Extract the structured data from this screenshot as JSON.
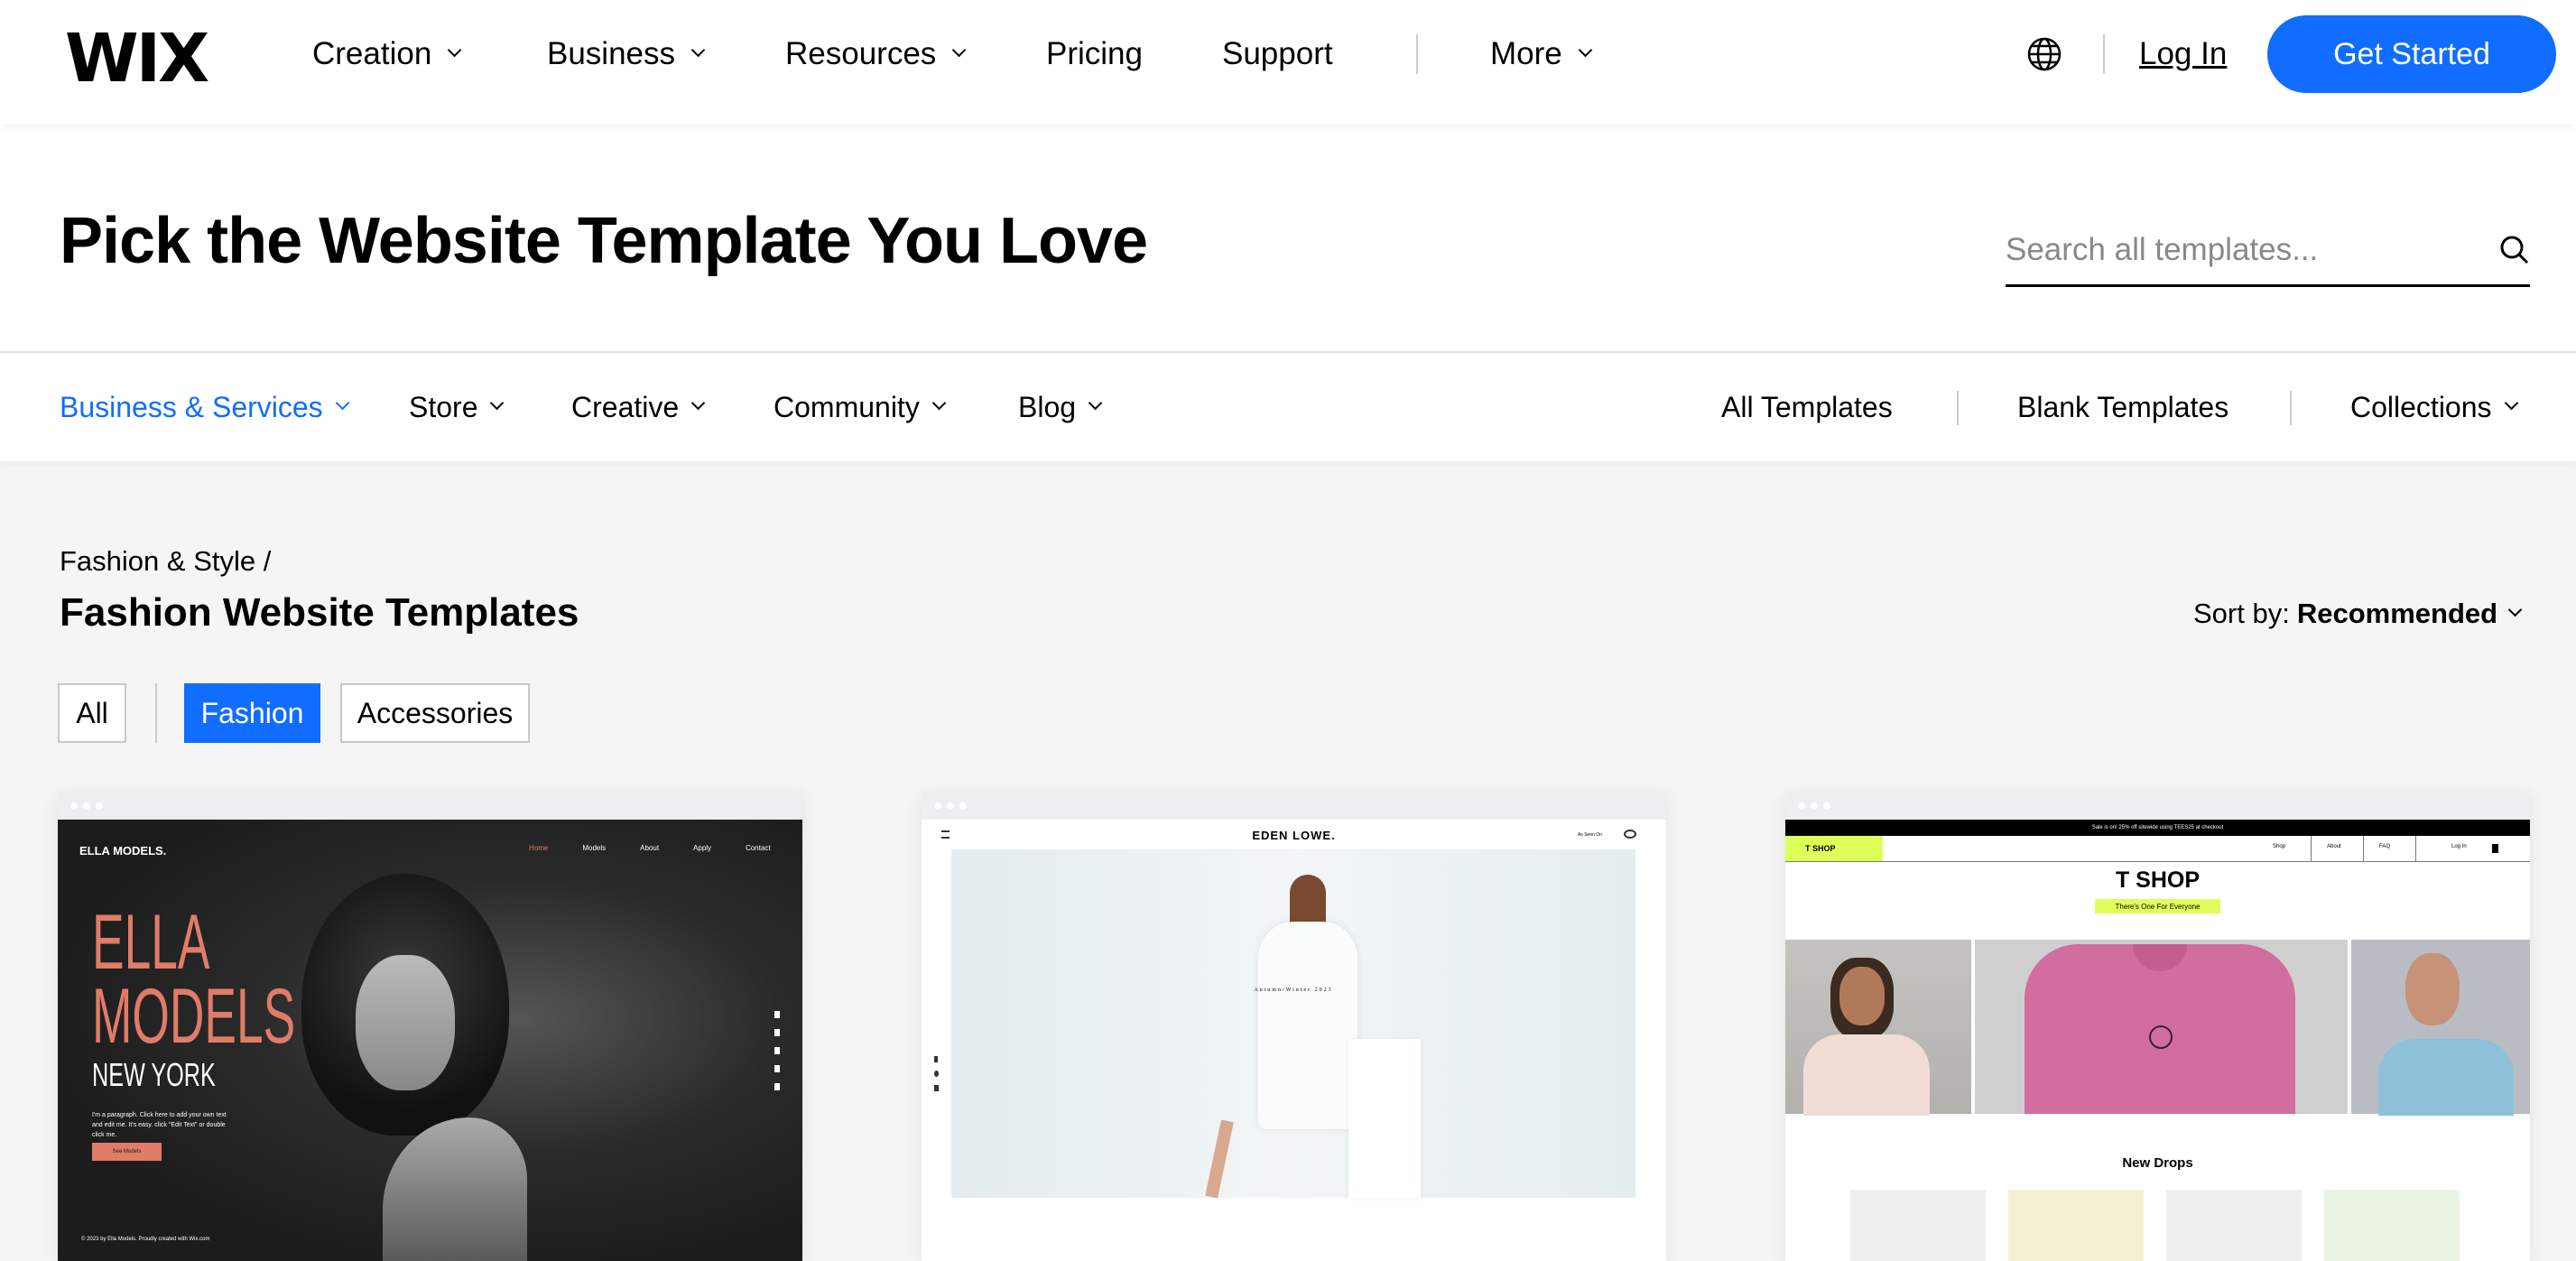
{
  "header": {
    "logo": "WIX",
    "nav": [
      {
        "label": "Creation"
      },
      {
        "label": "Business"
      },
      {
        "label": "Resources"
      },
      {
        "label": "Pricing"
      },
      {
        "label": "Support"
      },
      {
        "label": "More"
      }
    ],
    "login": "Log In",
    "cta": "Get Started",
    "accent": "#116dff"
  },
  "hero": {
    "title": "Pick the Website Template You Love",
    "search_placeholder": "Search all templates..."
  },
  "categories": {
    "left": [
      {
        "label": "Business & Services",
        "active": true
      },
      {
        "label": "Store"
      },
      {
        "label": "Creative"
      },
      {
        "label": "Community"
      },
      {
        "label": "Blog"
      }
    ],
    "right": [
      {
        "label": "All Templates"
      },
      {
        "label": "Blank Templates"
      },
      {
        "label": "Collections"
      }
    ]
  },
  "section": {
    "breadcrumb": "Fashion & Style /",
    "title": "Fashion Website Templates",
    "sort_label": "Sort by:",
    "sort_value": "Recommended",
    "filters": [
      {
        "label": "All"
      },
      {
        "label": "Fashion",
        "active": true
      },
      {
        "label": "Accessories"
      }
    ]
  },
  "templates": [
    {
      "brand": "ELLA MODELS.",
      "nav": [
        "Home",
        "Models",
        "About",
        "Apply",
        "Contact"
      ],
      "h1": "ELLA",
      "h2": "MODELS",
      "h3": "NEW YORK",
      "para": "I'm a paragraph. Click here to add your own text and edit me. It's easy. click \"Edit Text\" or double click me.",
      "button": "See Models",
      "footer": "© 2023 by Ella Models. Proudly created with Wix.com"
    },
    {
      "brand": "EDEN LOWE.",
      "nav_right": "As Seen On",
      "caption": "Autumn/Winter 2023"
    },
    {
      "banner": "Sale is on! 25% off sitewide using TEES25 at checkout",
      "logo": "T SHOP",
      "nav": [
        "Shop",
        "About",
        "FAQ"
      ],
      "login": "Log In",
      "title": "T SHOP",
      "tagline": "There's One For Everyone",
      "section": "New Drops"
    }
  ]
}
